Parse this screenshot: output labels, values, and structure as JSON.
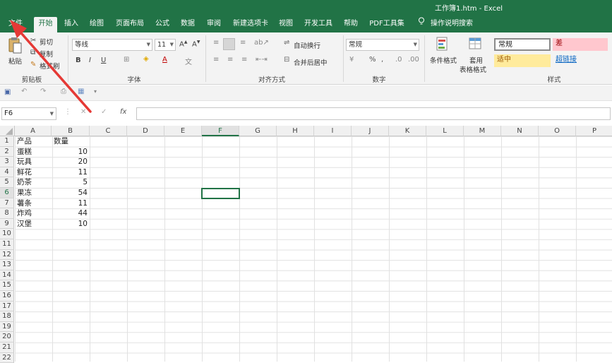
{
  "window": {
    "title": "工作簿1.htm  -  Excel"
  },
  "tabs": [
    {
      "label": "文件"
    },
    {
      "label": "开始"
    },
    {
      "label": "插入"
    },
    {
      "label": "绘图"
    },
    {
      "label": "页面布局"
    },
    {
      "label": "公式"
    },
    {
      "label": "数据"
    },
    {
      "label": "审阅"
    },
    {
      "label": "新建选项卡"
    },
    {
      "label": "视图"
    },
    {
      "label": "开发工具"
    },
    {
      "label": "帮助"
    },
    {
      "label": "PDF工具集"
    },
    {
      "label": "操作说明搜索"
    }
  ],
  "ribbon": {
    "clipboard": {
      "paste": "粘贴",
      "cut": "剪切",
      "copy": "复制",
      "format_painter": "格式刷",
      "group": "剪贴板"
    },
    "font": {
      "font_name": "等线",
      "font_size": "11",
      "group": "字体"
    },
    "alignment": {
      "wrap": "自动换行",
      "merge": "合并后居中",
      "group": "对齐方式"
    },
    "number": {
      "format": "常规",
      "group": "数字"
    },
    "styles": {
      "conditional": "条件格式",
      "table_format_1": "套用",
      "table_format_2": "表格格式",
      "normal": "常规",
      "bad": "差",
      "neutral": "适中",
      "hyperlink": "超链接",
      "group": "样式"
    }
  },
  "formula_bar": {
    "name_box": "F6",
    "fx": "fx",
    "value": ""
  },
  "columns": [
    "A",
    "B",
    "C",
    "D",
    "E",
    "F",
    "G",
    "H",
    "I",
    "J",
    "K",
    "L",
    "M",
    "N",
    "O",
    "P"
  ],
  "rows": [
    "1",
    "2",
    "3",
    "4",
    "5",
    "6",
    "7",
    "8",
    "9",
    "10",
    "11",
    "12",
    "13",
    "14",
    "15",
    "16",
    "17",
    "18",
    "19",
    "20",
    "21",
    "22"
  ],
  "sheet": {
    "header": {
      "a": "产品",
      "b": "数量"
    },
    "data": [
      {
        "a": "蛋糕",
        "b": "10"
      },
      {
        "a": "玩具",
        "b": "20"
      },
      {
        "a": "鲜花",
        "b": "11"
      },
      {
        "a": "奶茶",
        "b": "5"
      },
      {
        "a": "果冻",
        "b": "54"
      },
      {
        "a": "薯条",
        "b": "11"
      },
      {
        "a": "炸鸡",
        "b": "44"
      },
      {
        "a": "汉堡",
        "b": "10"
      }
    ]
  },
  "colors": {
    "brand": "#217346",
    "arrow": "#e53935",
    "bad_bg": "#ffc7ce",
    "bad_fg": "#9c0006",
    "neutral_bg": "#ffeb9c",
    "neutral_fg": "#9c5700"
  }
}
